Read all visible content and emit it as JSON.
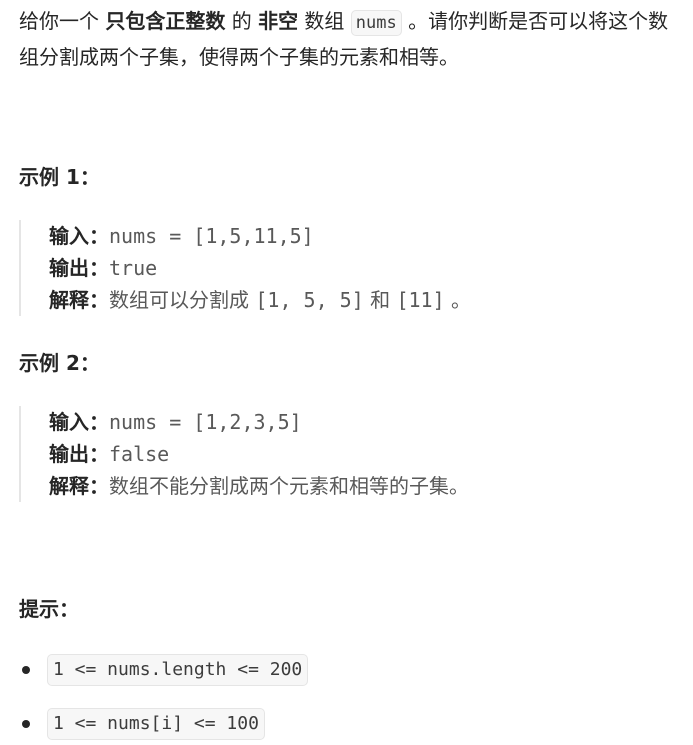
{
  "description": {
    "part1": "给你一个 ",
    "bold1": "只包含正整数",
    "part2": " 的 ",
    "bold2": "非空",
    "part3": " 数组 ",
    "code1": "nums",
    "part4": " 。请你判断是否可以将这个数组分割成两个子集，使得两个子集的元素和相等。"
  },
  "example1": {
    "heading": "示例 1：",
    "input_label": "输入：",
    "input_value": "nums = [1,5,11,5]",
    "output_label": "输出：",
    "output_value": "true",
    "explain_label": "解释：",
    "explain_text1": "数组可以分割成 ",
    "explain_code1": "[1, 5, 5]",
    "explain_text2": " 和 ",
    "explain_code2": "[11]",
    "explain_text3": " 。"
  },
  "example2": {
    "heading": "示例 2：",
    "input_label": "输入：",
    "input_value": "nums = [1,2,3,5]",
    "output_label": "输出：",
    "output_value": "false",
    "explain_label": "解释：",
    "explain_text": "数组不能分割成两个元素和相等的子集。"
  },
  "constraints": {
    "heading": "提示：",
    "items": [
      "1 <= nums.length <= 200",
      "1 <= nums[i] <= 100"
    ]
  }
}
